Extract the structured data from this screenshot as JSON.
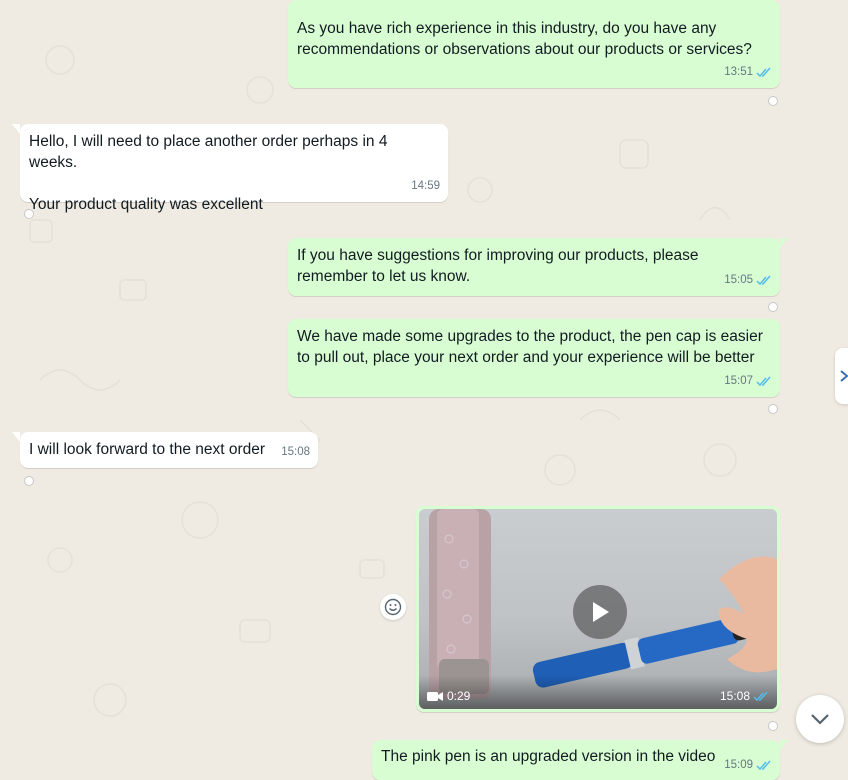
{
  "messages": [
    {
      "id": "m1",
      "direction": "out",
      "text": "As you have rich experience in this industry, do you have any\nrecommendations or observations about our products or services?",
      "time": "13:51"
    },
    {
      "id": "m2",
      "direction": "in",
      "text": "Hello, I will need to place another order perhaps in 4 weeks.\n\nYour product quality was excellent",
      "time": "14:59"
    },
    {
      "id": "m3",
      "direction": "out",
      "text": "If you have suggestions for improving our products, please\nremember to let us know.",
      "time": "15:05"
    },
    {
      "id": "m4",
      "direction": "out",
      "text": "We have made some upgrades to the product, the pen cap is easier\nto pull out, place your next order and your experience will be better",
      "time": "15:07"
    },
    {
      "id": "m5",
      "direction": "in",
      "text": "I will look forward to the next order",
      "time": "15:08"
    },
    {
      "id": "m6",
      "direction": "out",
      "type": "video",
      "duration": "0:29",
      "time": "15:08"
    },
    {
      "id": "m7",
      "direction": "out",
      "text": "The pink pen is an upgraded version in the video",
      "time": "15:09"
    }
  ],
  "icons": {
    "read_receipt": "double-check-icon",
    "reaction": "react-icon",
    "play": "play-icon",
    "video": "video-camera-icon",
    "emoji": "emoji-icon",
    "scroll_down": "chevron-down-icon",
    "side_panel": "chevron-right-icon"
  },
  "colors": {
    "outgoing_bubble": "#d9fdd3",
    "incoming_bubble": "#ffffff",
    "chat_background": "#efeae2",
    "read_tick": "#53bdeb",
    "meta_text": "#667781"
  }
}
